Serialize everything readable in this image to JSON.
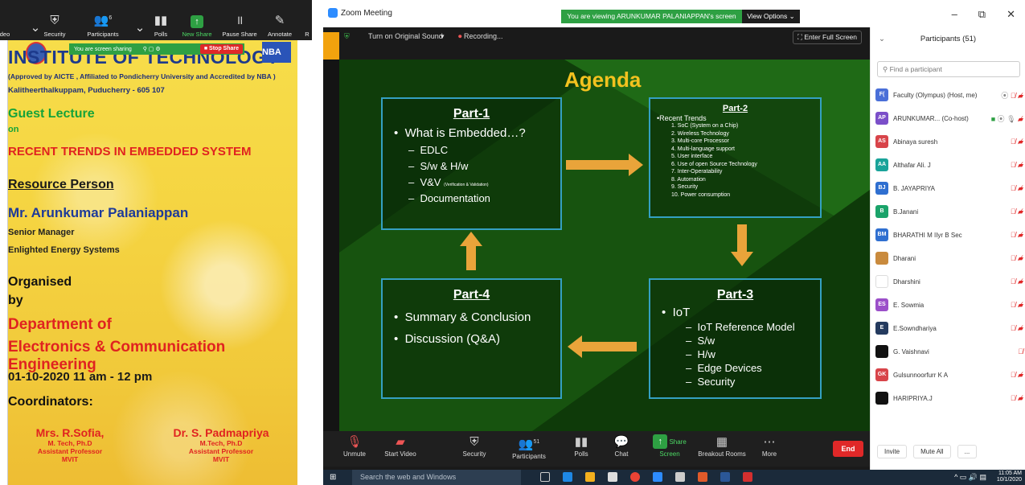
{
  "left_toolbar": {
    "items": [
      {
        "label": "deo",
        "icon": "video-icon"
      },
      {
        "label": "Security",
        "icon": "shield-icon"
      },
      {
        "label": "Participants",
        "icon": "participants-icon",
        "count": "6"
      },
      {
        "label": "Polls",
        "icon": "polls-icon"
      },
      {
        "label": "New Share",
        "icon": "share-icon"
      },
      {
        "label": "Pause Share",
        "icon": "pause-icon"
      },
      {
        "label": "Annotate",
        "icon": "pen-icon"
      },
      {
        "label": "R",
        "icon": "more-icon"
      }
    ],
    "share_banner": "You are screen sharing",
    "stop_share": "Stop Share"
  },
  "poster": {
    "institute": "INSTITUTE OF TECHNOLOGY",
    "nba": "NBA",
    "approved": "(Approved by AICTE , Affiliated to Pondicherry University and Accredited by NBA )",
    "address": "Kalitheerthalkuppam, Puducherry - 605 107",
    "guest_lecture": "Guest Lecture",
    "on": "on",
    "topic": "RECENT TRENDS IN EMBEDDED SYSTEM",
    "resource_person": "Resource Person",
    "speaker": "Mr. Arunkumar Palaniappan",
    "role": "Senior Manager",
    "company": "Enlighted Energy Systems",
    "organised": "Organised",
    "by": "by",
    "department": "Department of",
    "ece": "Electronics & Communication Engineering",
    "date": "01-10-2020  11 am - 12 pm",
    "coordinators": "Coordinators:",
    "coordinator_list": [
      {
        "name": "Mrs. R.Sofia,",
        "degree": "M. Tech, Ph.D",
        "position": "Assistant Professor",
        "org": "MVIT"
      },
      {
        "name": "Dr. S. Padmapriya",
        "degree": "M.Tech, Ph.D",
        "position": "Assistant Professor",
        "org": "MVIT"
      }
    ]
  },
  "zoom": {
    "window_title": "Zoom Meeting",
    "viewing_banner": "You are viewing ARUNKUMAR PALANIAPPAN's screen",
    "view_options": "View Options ⌄",
    "controls": {
      "minimize": "–",
      "restore": "⧉",
      "close": "✕"
    },
    "original_sound": "Turn on Original Sound",
    "recording": "Recording...",
    "full_screen": "Enter Full Screen"
  },
  "slide": {
    "title": "Agenda",
    "part1": {
      "title": "Part-1",
      "bullet": "What is Embedded…?",
      "subs": [
        "EDLC",
        "S/w & H/w",
        "V&V",
        "Documentation"
      ],
      "vv_note": "(Verification & Validation)"
    },
    "part2": {
      "title": "Part-2",
      "heading": "•Recent Trends",
      "items": [
        "1.  SoC (System on a Chip)",
        "2.  Wireless Technology",
        "3.  Multi-core Processor",
        "4.  Multi-language support",
        "5.  User interface",
        "6.  Use of open Source Technology",
        "7.  Inter-Operatability",
        "8.  Automation",
        "9.  Security",
        "10. Power consumption"
      ]
    },
    "part3": {
      "title": "Part-3",
      "bullet": "IoT",
      "subs": [
        "IoT Reference Model",
        "S/w",
        "H/w",
        "Edge Devices",
        "Security"
      ]
    },
    "part4": {
      "title": "Part-4",
      "bullets": [
        "Summary & Conclusion",
        "Discussion (Q&A)"
      ]
    }
  },
  "meeting_bar": {
    "items": [
      {
        "label": "Unmute",
        "icon": "mic-muted-icon"
      },
      {
        "label": "Start Video",
        "icon": "video-off-icon"
      },
      {
        "label": "Security",
        "icon": "shield-icon"
      },
      {
        "label": "Participants",
        "icon": "participants-icon",
        "count": "51"
      },
      {
        "label": "Polls",
        "icon": "polls-icon"
      },
      {
        "label": "Chat",
        "icon": "chat-icon",
        "badge": "1"
      },
      {
        "label": "Share Screen",
        "icon": "share-screen-icon"
      },
      {
        "label": "Breakout Rooms",
        "icon": "breakout-icon"
      },
      {
        "label": "More",
        "icon": "more-icon"
      }
    ],
    "end": "End"
  },
  "participants": {
    "title": "Participants (51)",
    "search_placeholder": "Find a participant",
    "list": [
      {
        "initials": "F(",
        "name": "Faculty (Olympus) (Host, me)",
        "color": "#4a6fd8"
      },
      {
        "initials": "AP",
        "name": "ARUNKUMAR... (Co-host)",
        "color": "#7b4fc9"
      },
      {
        "initials": "AS",
        "name": "Abinaya suresh",
        "color": "#d8444a"
      },
      {
        "initials": "AA",
        "name": "Althafar Ali. J",
        "color": "#1aa39a"
      },
      {
        "initials": "BJ",
        "name": "B. JAYAPRIYA",
        "color": "#2f6fd0"
      },
      {
        "initials": "B",
        "name": "B.Janani",
        "color": "#1aa36a"
      },
      {
        "initials": "BM",
        "name": "BHARATHI M IIyr B Sec",
        "color": "#2f6fd0"
      },
      {
        "initials": "",
        "name": "Dharani",
        "color": "#c98a3d"
      },
      {
        "initials": "",
        "name": "Dharshini",
        "color": "#ffffff"
      },
      {
        "initials": "ES",
        "name": "E. Sowmia",
        "color": "#9b4fc9"
      },
      {
        "initials": "E",
        "name": "E.Sowndhariya",
        "color": "#243a5e"
      },
      {
        "initials": "",
        "name": "G. Vaishnavi",
        "color": "#111111"
      },
      {
        "initials": "GK",
        "name": "Gulsunnoorfurr K A",
        "color": "#d8444a"
      },
      {
        "initials": "",
        "name": "HARIPRIYA.J",
        "color": "#111111"
      }
    ],
    "invite": "Invite",
    "mute_all": "Mute All",
    "more": "..."
  },
  "taskbar": {
    "search": "Search the web and Windows",
    "time": "11:05 AM",
    "date": "10/1/2020"
  }
}
